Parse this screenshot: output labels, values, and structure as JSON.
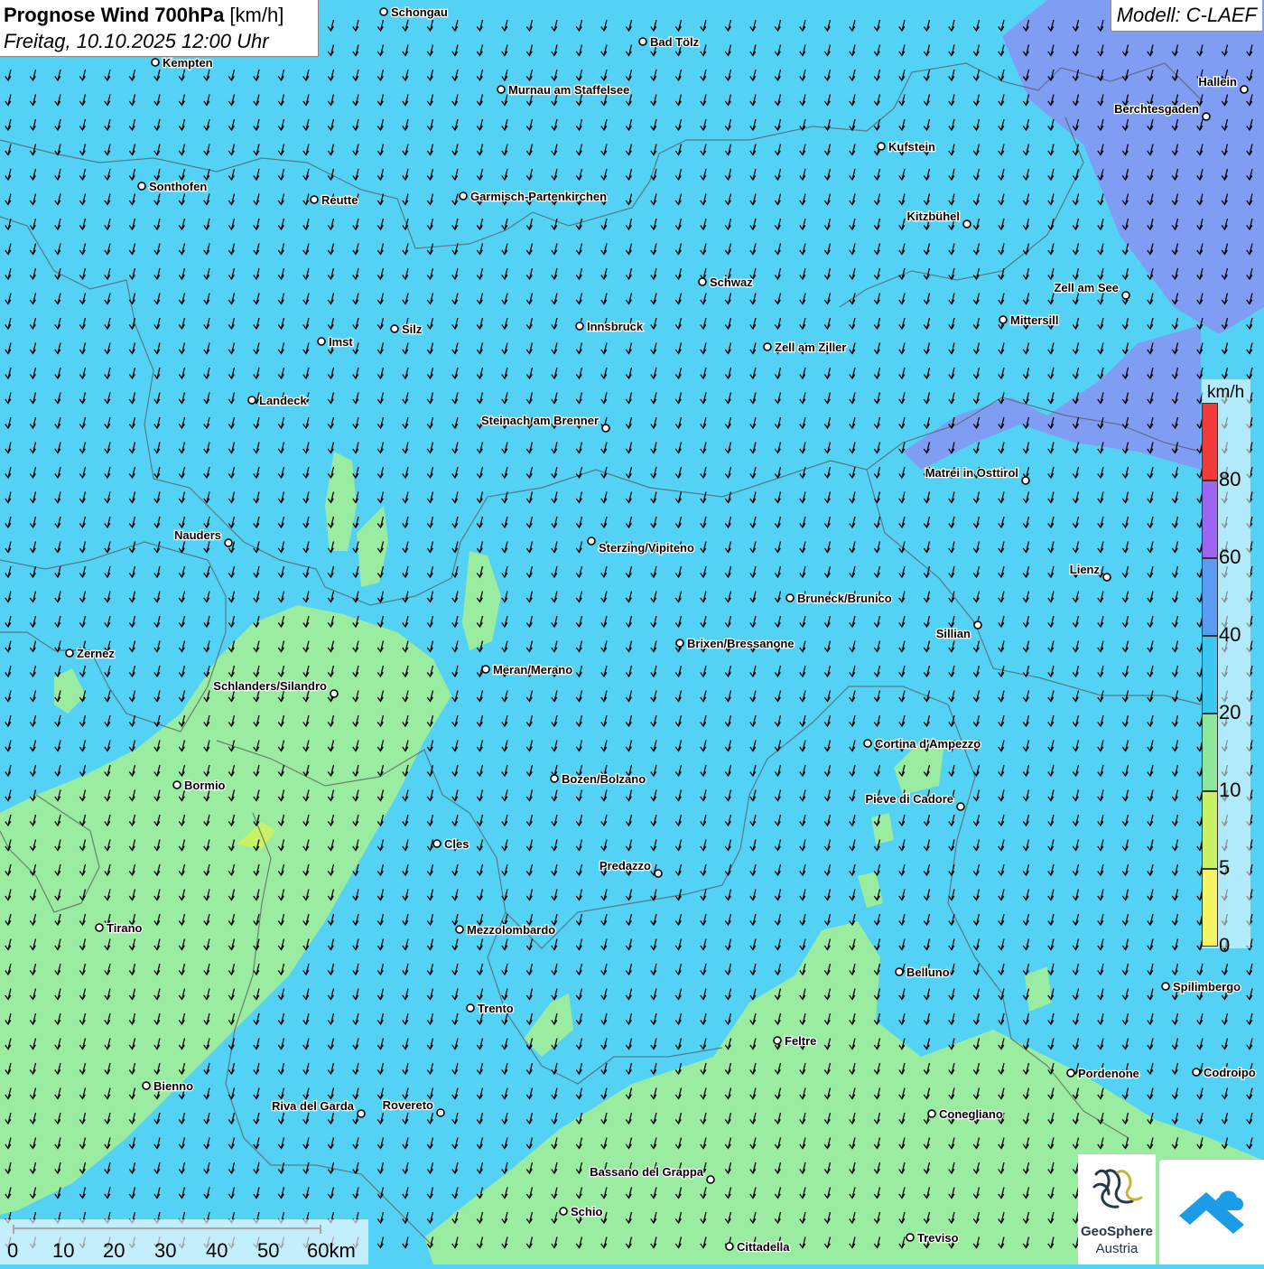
{
  "title": {
    "main_bold": "Prognose Wind 700hPa",
    "main_unit": " [km/h]",
    "datetime": "Freitag, 10.10.2025 12:00 Uhr"
  },
  "model": "Modell: C-LAEF",
  "legend": {
    "unit": "km/h",
    "classes": [
      {
        "from": 0,
        "to": 5,
        "color": "#f5f565"
      },
      {
        "from": 5,
        "to": 10,
        "color": "#c9f266"
      },
      {
        "from": 10,
        "to": 20,
        "color": "#8ee79a"
      },
      {
        "from": 20,
        "to": 40,
        "color": "#3cc8f0"
      },
      {
        "from": 40,
        "to": 60,
        "color": "#5b9cf0"
      },
      {
        "from": 60,
        "to": 80,
        "color": "#9c66f0"
      },
      {
        "from": 80,
        "to": 100,
        "color": "#f23a3a"
      }
    ],
    "tick_labels": [
      "0",
      "5",
      "10",
      "20",
      "40",
      "60",
      "80"
    ]
  },
  "scalebar": {
    "labels": [
      "0",
      "10",
      "20",
      "30",
      "40",
      "50",
      "60km"
    ]
  },
  "cities": [
    {
      "name": "Schongau"
    },
    {
      "name": "Bad Tölz"
    },
    {
      "name": "Kempten"
    },
    {
      "name": "Murnau am Staffelsee"
    },
    {
      "name": "Hallein"
    },
    {
      "name": "Berchtesgaden"
    },
    {
      "name": "Kufstein"
    },
    {
      "name": "Sonthofen"
    },
    {
      "name": "Reutte"
    },
    {
      "name": "Garmisch-Partenkirchen"
    },
    {
      "name": "Kitzbühel"
    },
    {
      "name": "Schwaz"
    },
    {
      "name": "Zell am See"
    },
    {
      "name": "Mittersill"
    },
    {
      "name": "Innsbruck"
    },
    {
      "name": "Silz"
    },
    {
      "name": "Imst"
    },
    {
      "name": "Zell am Ziller"
    },
    {
      "name": "Landeck"
    },
    {
      "name": "Steinach am Brenner"
    },
    {
      "name": "Matrei in Osttirol"
    },
    {
      "name": "Nauders"
    },
    {
      "name": "Sterzing/Vipiteno"
    },
    {
      "name": "Lienz"
    },
    {
      "name": "Bruneck/Brunico"
    },
    {
      "name": "Sillian"
    },
    {
      "name": "Zernez"
    },
    {
      "name": "Brixen/Bressanone"
    },
    {
      "name": "Meran/Merano"
    },
    {
      "name": "Schlanders/Silandro"
    },
    {
      "name": "Cortina d'Ampezzo"
    },
    {
      "name": "Bozen/Bolzano"
    },
    {
      "name": "Bormio"
    },
    {
      "name": "Pieve di Cadore"
    },
    {
      "name": "Cles"
    },
    {
      "name": "Predazzo"
    },
    {
      "name": "Tirano"
    },
    {
      "name": "Mezzolombardo"
    },
    {
      "name": "Belluno"
    },
    {
      "name": "Spilimbergo"
    },
    {
      "name": "Trento"
    },
    {
      "name": "Feltre"
    },
    {
      "name": "Bienno"
    },
    {
      "name": "Pordenone"
    },
    {
      "name": "Codroipo"
    },
    {
      "name": "Riva del Garda"
    },
    {
      "name": "Rovereto"
    },
    {
      "name": "Conegliano"
    },
    {
      "name": "Bassano del Grappa"
    },
    {
      "name": "Schio"
    },
    {
      "name": "Treviso"
    },
    {
      "name": "Cittadella"
    }
  ],
  "logos": {
    "geosphere_line1": "GeoSphere",
    "geosphere_line2": "Austria"
  },
  "colors": {
    "wind_20_40": "#53d2f6",
    "wind_10_20": "#9aeca0",
    "wind_40_60": "#7f9ef3",
    "arrow": "#000000"
  }
}
